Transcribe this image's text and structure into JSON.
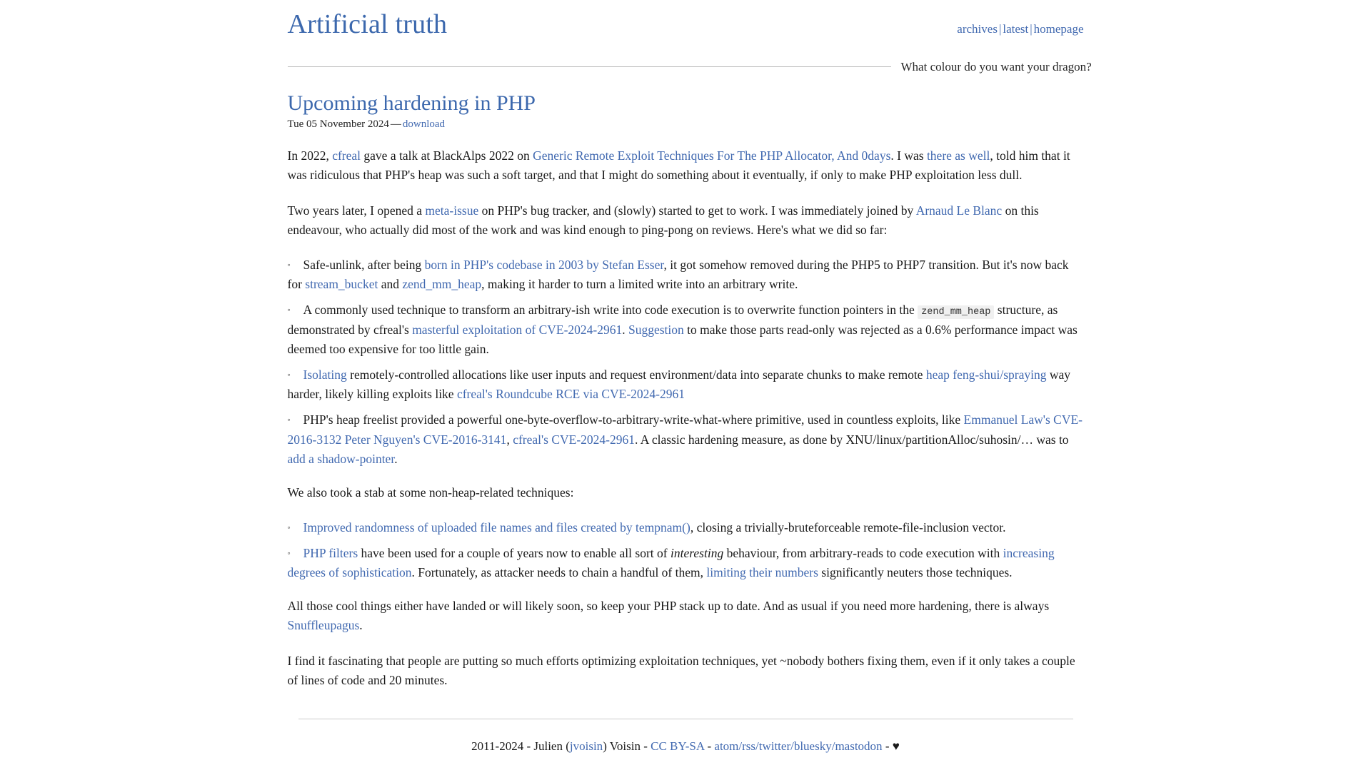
{
  "site": {
    "title": "Artificial truth",
    "tagline": "What colour do you want your dragon?",
    "nav": [
      {
        "label": "archives"
      },
      {
        "label": "latest"
      },
      {
        "label": "homepage"
      }
    ],
    "nav_separator": "|"
  },
  "post": {
    "title": "Upcoming hardening in PHP",
    "date": "Tue 05 November 2024",
    "meta_dash": "—",
    "download_label": "download",
    "paragraph_1": {
      "t1": "In 2022, ",
      "l1": "cfreal",
      "t2": " gave a talk at BlackAlps 2022 on ",
      "l2": "Generic Remote Exploit Techniques For The PHP Allocator, And 0days",
      "t3": ". I was ",
      "l3": "there as well",
      "t4": ", told him that it was ridiculous that PHP's heap was such a soft target, and that I might do something about it eventually, if only to make PHP exploitation less dull."
    },
    "paragraph_2": {
      "t1": "Two years later, I opened a ",
      "l1": "meta-issue",
      "t2": " on PHP's bug tracker, and (slowly) started to get to work. I was immediately joined by ",
      "l2": "Arnaud Le Blanc",
      "t3": " on this endeavour, who actually did most of the work and was kind enough to ping-pong on reviews. Here's what we did so far:"
    },
    "bullet_marker": "◦",
    "list_1": {
      "item_1": {
        "t1": "Safe-unlink, after being ",
        "l1": "born in PHP's codebase in 2003 by Stefan Esser",
        "t2": ", it got somehow removed during the PHP5 to PHP7 transition. But it's now back for ",
        "l2": "stream_bucket",
        "t3": " and ",
        "l3": "zend_mm_heap",
        "t4": ", making it harder to turn a limited write into an arbitrary write."
      },
      "item_2": {
        "t1": "A commonly used technique to transform an arbitrary-ish write into code execution is to overwrite function pointers in the ",
        "code1": "zend_mm_heap",
        "t2": " structure, as demonstrated by cfreal's ",
        "l1": "masterful exploitation of CVE-2024-2961",
        "t3": ". ",
        "l2": "Suggestion",
        "t4": " to make those parts read-only was rejected as a 0.6% performance impact was deemed too expensive for too little gain."
      },
      "item_3": {
        "l1": "Isolating",
        "t1": " remotely-controlled allocations like user inputs and request environment/data into separate chunks to make remote ",
        "l2": "heap feng-shui/spraying",
        "t2": " way harder, likely killing exploits like ",
        "l3": "cfreal's Roundcube RCE via CVE-2024-2961"
      },
      "item_4": {
        "t1": "PHP's heap freelist provided a powerful one-byte-overflow-to-arbitrary-write-what-where primitive, used in countless exploits, like ",
        "l1": "Emmanuel Law's CVE-2016-3132",
        "t2": " ",
        "l2": "Peter Nguyen's CVE-2016-3141",
        "t3": ", ",
        "l3": "cfreal's CVE-2024-2961",
        "t4": ". A classic hardening measure, as done by XNU/linux/partitionAlloc/suhosin/… was to ",
        "l4": "add a shadow-pointer",
        "t5": "."
      }
    },
    "paragraph_3": "We also took a stab at some non-heap-related techniques:",
    "list_2": {
      "item_1": {
        "l1": "Improved randomness of uploaded file names and files created by tempnam()",
        "t1": ", closing a trivially-bruteforceable remote-file-inclusion vector."
      },
      "item_2": {
        "l1": "PHP filters",
        "t1": " have been used for a couple of years now to enable all sort of ",
        "em1": "interesting",
        "t2": " behaviour, from arbitrary-reads to code execution with ",
        "l2": "increasing degrees of sophistication",
        "t3": ". Fortunately, as attacker needs to chain a handful of them, ",
        "l3": "limiting their numbers",
        "t4": " significantly neuters those techniques."
      }
    },
    "paragraph_4": {
      "t1": "All those cool things either have landed or will likely soon, so keep your PHP stack up to date. And as usual if you need more hardening, there is always ",
      "l1": "Snuffleupagus",
      "t2": "."
    },
    "paragraph_5": "I find it fascinating that people are putting so much efforts optimizing exploitation techniques, yet ~nobody bothers fixing them, even if it only takes a couple of lines of code and 20 minutes."
  },
  "footer": {
    "years": "2011-2024 - Julien (",
    "author_link": "jvoisin",
    "after_author": ") Voisin - ",
    "license": "CC BY-SA",
    "sep1": " - ",
    "feeds": "atom/rss/twitter/bluesky/mastodon",
    "sep2": " - ",
    "heart": "♥"
  },
  "colors": {
    "link": "#4169b0",
    "title": "#3c68ad",
    "text": "#1a1a1a",
    "rule": "#bdbdbd",
    "code_bg": "#f0f0f0"
  }
}
